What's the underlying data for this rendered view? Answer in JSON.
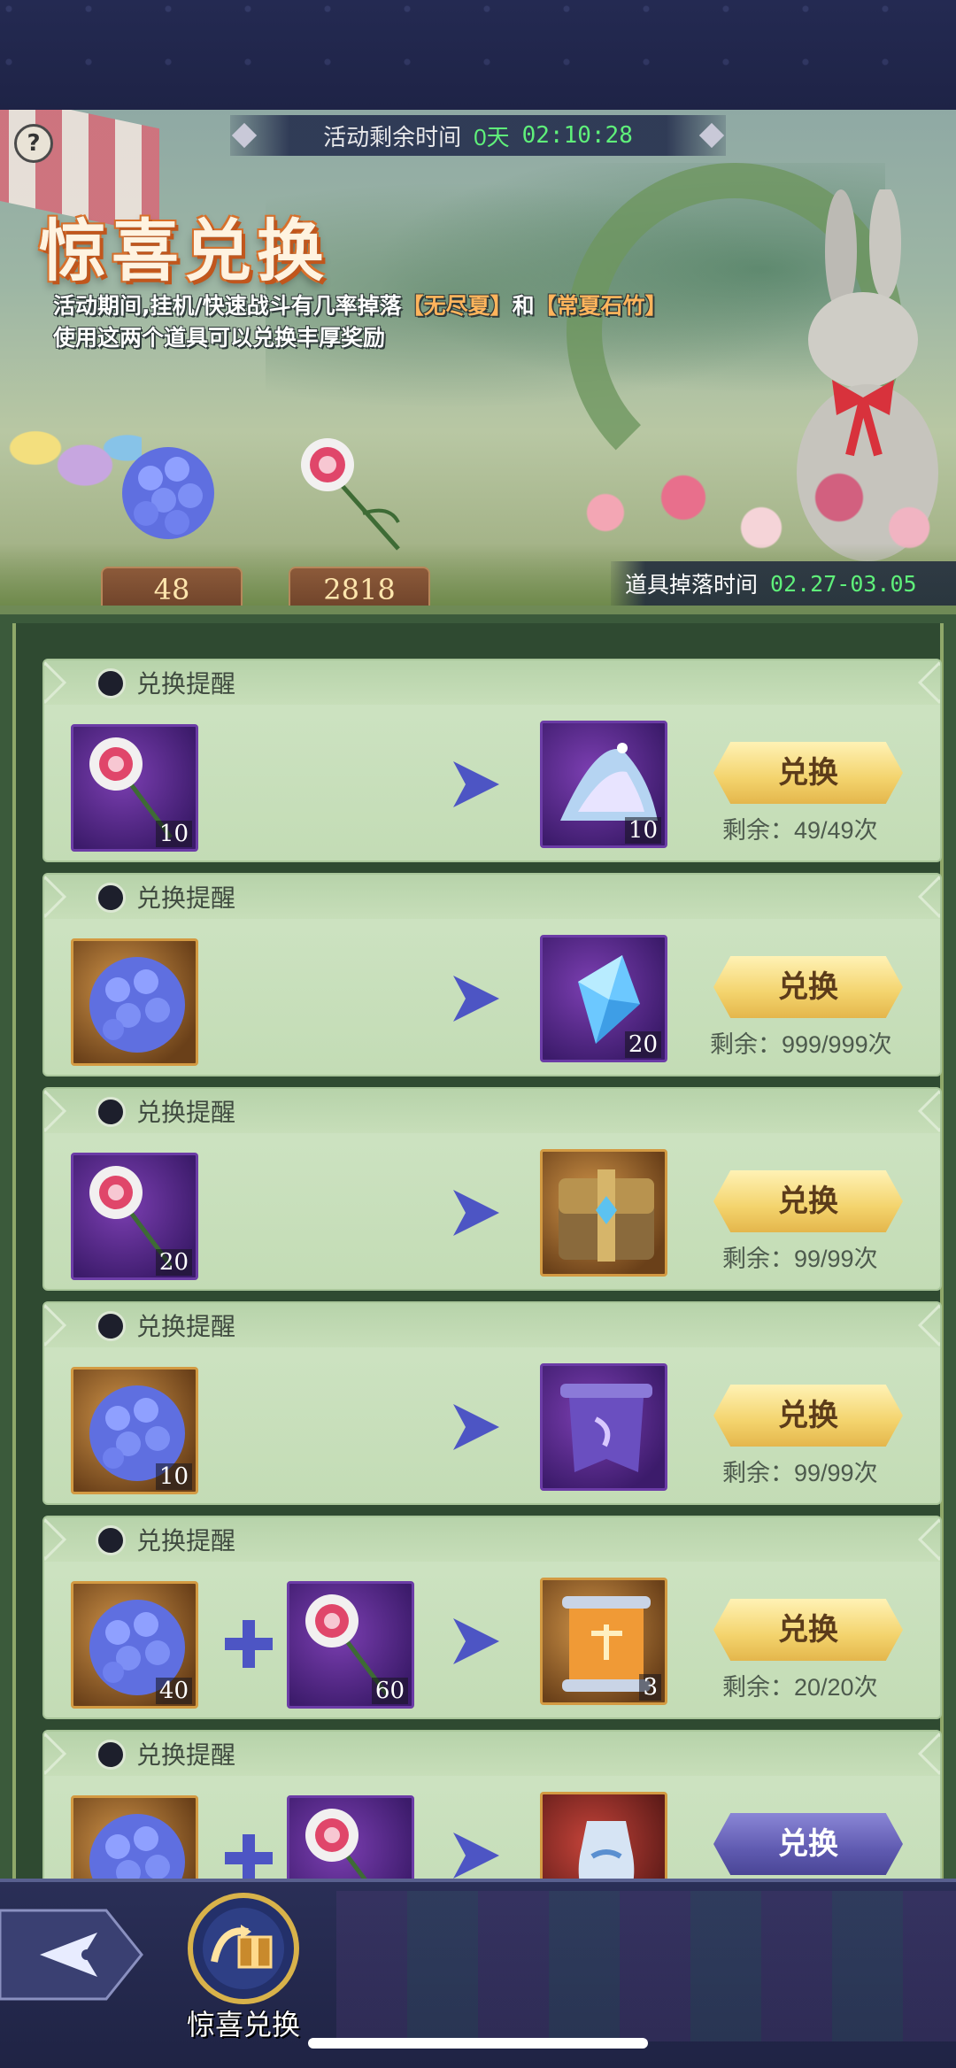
{
  "event": {
    "timer_label": "活动剩余时间",
    "timer_days": "0天",
    "timer_clock": "02:10:28",
    "title": "惊喜兑换",
    "desc_line1_pre": "活动期间,挂机/快速战斗有几率掉落",
    "desc_item1": "【无尽夏】",
    "desc_and": "和",
    "desc_item2": "【常夏石竹】",
    "desc_line2": "使用这两个道具可以兑换丰厚奖励",
    "help_label": "?",
    "drop_time_label": "道具掉落时间",
    "drop_time_value": "02.27-03.05"
  },
  "tokens": {
    "hydrangea_count": "48",
    "carnation_count": "2818"
  },
  "cards": [
    {
      "title": "兑换提醒",
      "cost1": "10",
      "reward": "10",
      "button": "兑换",
      "remain": "剩余：49/49次"
    },
    {
      "title": "兑换提醒",
      "cost1": "",
      "reward": "20",
      "button": "兑换",
      "remain": "剩余：999/999次"
    },
    {
      "title": "兑换提醒",
      "cost1": "20",
      "reward": "",
      "button": "兑换",
      "remain": "剩余：99/99次"
    },
    {
      "title": "兑换提醒",
      "cost1": "10",
      "reward": "",
      "button": "兑换",
      "remain": "剩余：99/99次"
    },
    {
      "title": "兑换提醒",
      "cost1": "40",
      "cost2": "60",
      "reward": "3",
      "button": "兑换",
      "remain": "剩余：20/20次"
    },
    {
      "title": "兑换提醒",
      "cost1": "",
      "cost2": "",
      "reward": "",
      "button": "兑换",
      "remain": ""
    }
  ],
  "nav": {
    "tab_label": "惊喜兑换"
  },
  "colors": {
    "timer_green": "#5ff07a",
    "highlight_orange": "#ffb45c",
    "button_gold": "#f3d36c",
    "button_purple": "#5f5ab0"
  }
}
